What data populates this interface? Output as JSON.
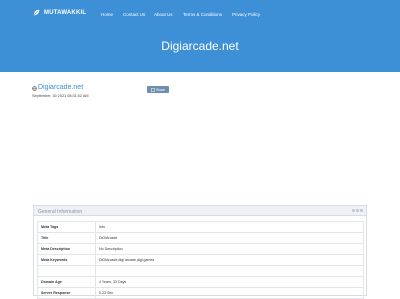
{
  "brand": {
    "name": "MUTAWAKKIL",
    "logo_icon": "leaf-icon"
  },
  "nav": [
    {
      "label": "Home"
    },
    {
      "label": "Contact Us"
    },
    {
      "label": "About Us"
    },
    {
      "label": "Terms & Conditions"
    },
    {
      "label": "Privacy Policy"
    }
  ],
  "hero": {
    "title": "Digiarcade.net"
  },
  "site": {
    "name": "Digiarcade.net",
    "date": "September, 30 2021 08:31:02 AM",
    "share_label": "Share",
    "favicon": "globe-icon"
  },
  "panel": {
    "title": "General Information",
    "rows": [
      {
        "key": "Meta Tags",
        "value": "Info"
      },
      {
        "key": "Title",
        "value": "DiGiArcade"
      },
      {
        "key": "Meta Description",
        "value": "No Description"
      },
      {
        "key": "Meta Keywords",
        "value": "DiGiArcade,digi arcade,digi games"
      },
      {
        "key": "",
        "value": ""
      },
      {
        "key": "Domain Age",
        "value": "4 Years, 33 Days"
      },
      {
        "key": "Server Response",
        "value": "0.23 Sec"
      }
    ]
  },
  "colors": {
    "hero": "#3d8fd6",
    "link": "#3d8fd6"
  }
}
